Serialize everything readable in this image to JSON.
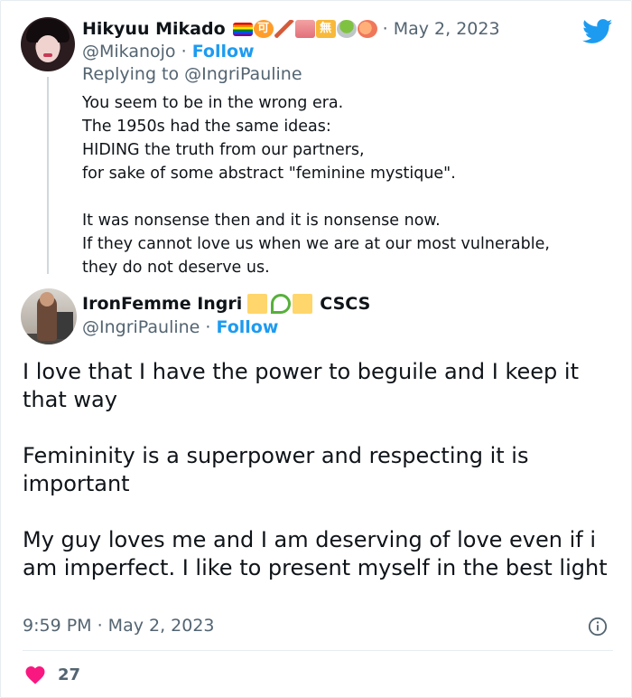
{
  "parent_tweet": {
    "display_name": "Hikyuu Mikado",
    "name_emojis": [
      "rainbow-flag",
      "ke-button",
      "feather",
      "building",
      "mu-button",
      "matcha-bowl",
      "peach"
    ],
    "date": "May 2, 2023",
    "date_prefix": "·",
    "handle": "@Mikanojo",
    "separator": "·",
    "follow_label": "Follow",
    "replying_to": "Replying to @IngriPauline",
    "text": "You seem to be in the wrong era.\nThe 1950s had the same ideas:\nHIDING the truth from our partners,\nfor sake of some abstract \"feminine mystique\".\n\nIt was nonsense then and it is nonsense now.\nIf they cannot love us when we are at our most vulnerable,\nthey do not deserve us."
  },
  "main_tweet": {
    "display_name": "IronFemme Ingri",
    "name_suffix": "CSCS",
    "name_emojis": [
      "yellow-square",
      "sprout",
      "yellow-square"
    ],
    "handle": "@IngriPauline",
    "separator": "·",
    "follow_label": "Follow",
    "text": "I love that I have the power to beguile and I keep it that way\n\nFemininity is a superpower and respecting it is important\n\nMy guy loves me and I am deserving of love even if i am imperfect. I like to present myself in the best light",
    "timestamp": "9:59 PM · May 2, 2023",
    "like_count": "27"
  },
  "colors": {
    "accent": "#1d9bf0",
    "text_primary": "#0f1419",
    "text_secondary": "#536471",
    "heart": "#f91880",
    "divider": "#e6ecf0"
  },
  "icons": [
    "twitter-bird-icon",
    "info-icon",
    "heart-icon"
  ]
}
